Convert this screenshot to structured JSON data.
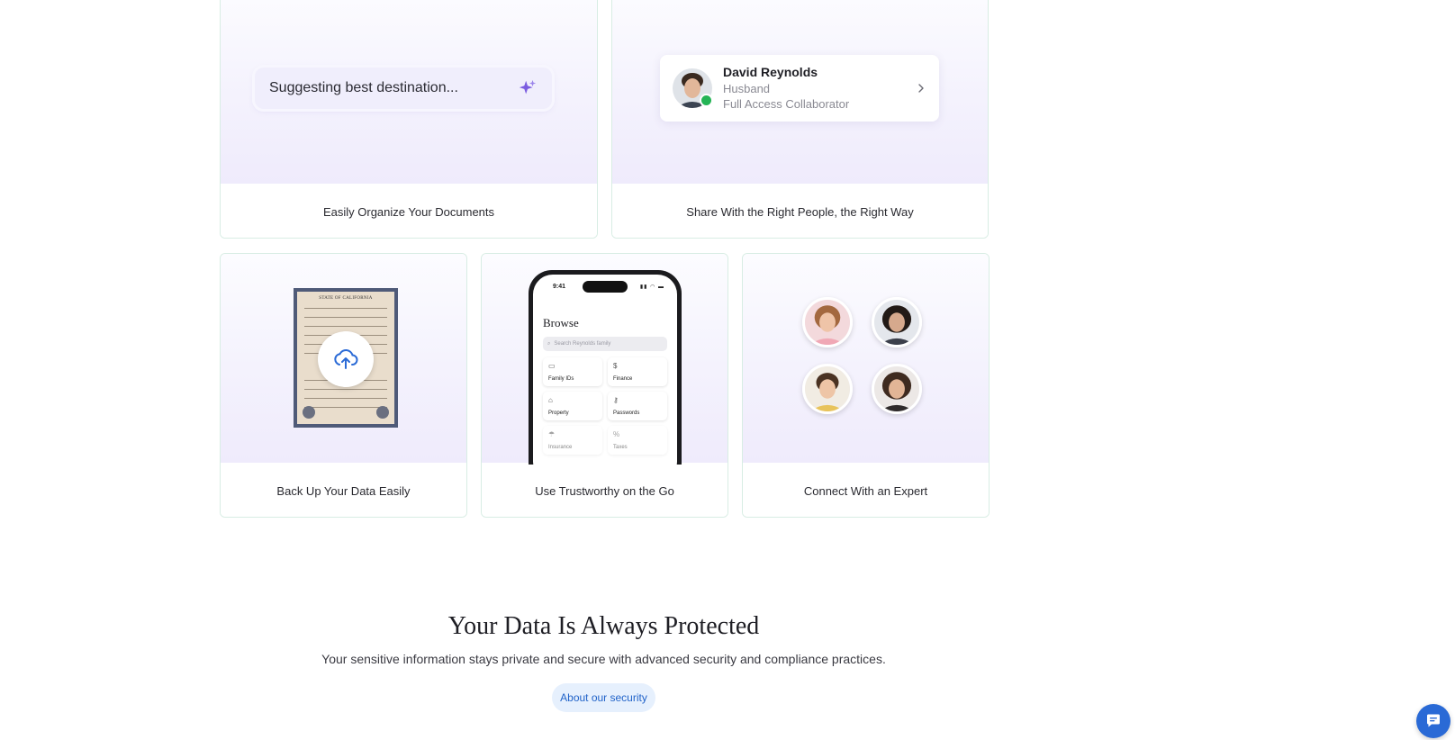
{
  "cards": {
    "organize": {
      "caption": "Easily Organize Your Documents",
      "suggestion_text": "Suggesting best destination..."
    },
    "share": {
      "caption": "Share With the Right People, the Right Way",
      "person": {
        "name": "David Reynolds",
        "relation": "Husband",
        "access": "Full Access Collaborator",
        "status": "online"
      }
    },
    "backup": {
      "caption": "Back Up Your Data Easily",
      "document_title": "STATE OF CALIFORNIA"
    },
    "mobile": {
      "caption": "Use Trustworthy on the Go",
      "phone": {
        "time": "9:41",
        "screen_title": "Browse",
        "search_placeholder": "Search Reynolds family",
        "tiles": [
          {
            "label": "Family IDs",
            "icon": "id-card-icon"
          },
          {
            "label": "Finance",
            "icon": "dollar-icon"
          },
          {
            "label": "Property",
            "icon": "home-icon"
          },
          {
            "label": "Passwords",
            "icon": "key-icon"
          },
          {
            "label": "Insurance",
            "icon": "umbrella-icon"
          },
          {
            "label": "Taxes",
            "icon": "percent-icon"
          }
        ]
      }
    },
    "expert": {
      "caption": "Connect With an Expert"
    }
  },
  "security": {
    "title": "Your Data Is Always Protected",
    "subtitle": "Your sensitive information stays private and secure with advanced security and compliance practices.",
    "button_label": "About our security"
  },
  "colors": {
    "accent": "#2163c9",
    "button_bg": "#e6f0fd",
    "card_border": "#d8ede4",
    "sparkle": "#7b5ce0",
    "online": "#24b455",
    "chat_fab": "#2a6ad6"
  }
}
